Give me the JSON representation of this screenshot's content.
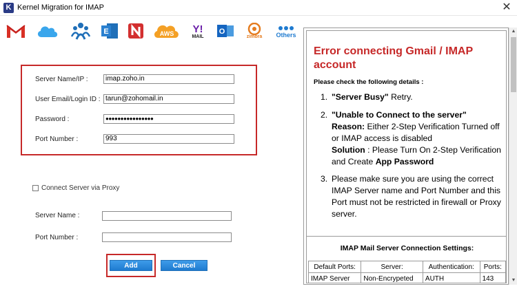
{
  "window": {
    "title": "Kernel Migration for IMAP",
    "app_icon_letter": "K",
    "close_glyph": "✕"
  },
  "providers": [
    {
      "name": "gmail-icon",
      "label": ""
    },
    {
      "name": "icloud-icon",
      "label": ""
    },
    {
      "name": "people-icon",
      "label": ""
    },
    {
      "name": "exchange-icon",
      "label": ""
    },
    {
      "name": "netease-icon",
      "label": ""
    },
    {
      "name": "aws-icon",
      "label": "AWS"
    },
    {
      "name": "yahoo-icon",
      "label": "MAIL"
    },
    {
      "name": "outlook-icon",
      "label": ""
    },
    {
      "name": "zimbra-icon",
      "label": "zimbra"
    },
    {
      "name": "others-icon",
      "label": "Others"
    }
  ],
  "form": {
    "server_label": "Server Name/IP :",
    "server_value": "imap.zoho.in",
    "email_label": "User Email/Login ID :",
    "email_value": "tarun@zohomail.in",
    "password_label": "Password :",
    "password_value": "●●●●●●●●●●●●●●●●",
    "port_label": "Port Number :",
    "port_value": "993"
  },
  "proxy": {
    "checkbox_label": "Connect Server via Proxy",
    "checked": false,
    "server_label": "Server Name :",
    "server_value": "",
    "port_label": "Port Number :",
    "port_value": ""
  },
  "buttons": {
    "add": "Add",
    "cancel": "Cancel"
  },
  "help": {
    "title": "Error connecting Gmail / IMAP account",
    "intro": "Please check the following details :",
    "item1_num": "1.",
    "item1_bold": "\"Server Busy\"",
    "item1_rest": " Retry.",
    "item2_num": "2.",
    "item2_bold": "\"Unable to Connect to the server\"",
    "item2_reason_label": "Reason:",
    "item2_reason": " Either 2-Step Verification Turned off or IMAP access is disabled",
    "item2_solution_label": "Solution",
    "item2_solution": " : Please Turn On 2-Step Verification and Create ",
    "item2_solution_bold": "App Password",
    "item3_num": "3.",
    "item3_text": "Please make sure you are using the correct IMAP Server name and Port Number and this Port must not be restricted in firewall or Proxy server.",
    "settings_heading": "IMAP Mail Server Connection Settings:",
    "table_headers": [
      "Default Ports:",
      "Server:",
      "Authentication:",
      "Ports:"
    ],
    "table_row": [
      "IMAP Server",
      "Non-Encrypeted",
      "AUTH",
      "143"
    ]
  },
  "colors": {
    "accent_red": "#c62828",
    "button_blue": "#1f7bd0"
  }
}
